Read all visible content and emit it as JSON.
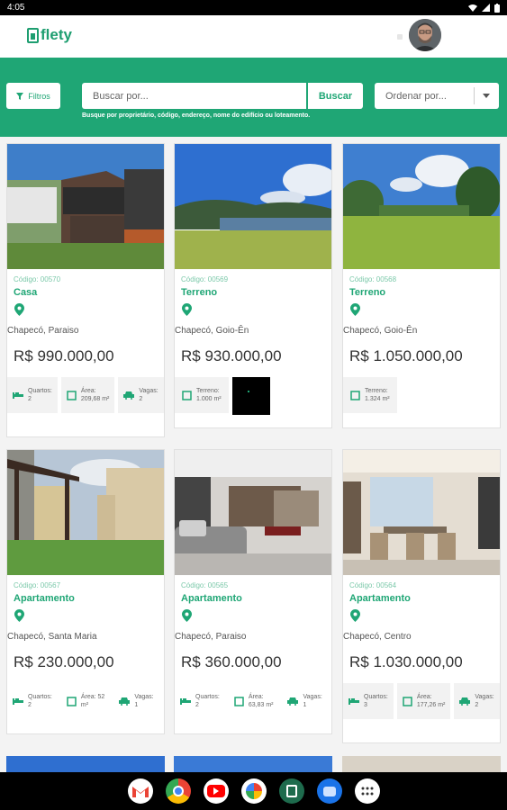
{
  "status": {
    "time": "4:05"
  },
  "app": {
    "brand": "flety"
  },
  "search": {
    "filter_label": "Filtros",
    "placeholder": "Buscar por...",
    "button_label": "Buscar",
    "sort_placeholder": "Ordenar por...",
    "hint": "Busque por proprietário, código, endereço, nome do edifício ou loteamento."
  },
  "listings": [
    {
      "code": "Código: 00570",
      "type": "Casa",
      "location": "Chapecó, Paraiso",
      "price": "R$ 990.000,00",
      "specs": [
        {
          "icon": "bed-icon",
          "label": "Quartos:",
          "value": "2"
        },
        {
          "icon": "area-icon",
          "label": "Área:",
          "value": "209,68 m²"
        },
        {
          "icon": "car-icon",
          "label": "Vagas:",
          "value": "2"
        }
      ]
    },
    {
      "code": "Código: 00569",
      "type": "Terreno",
      "location": "Chapecó, Goio-Ên",
      "price": "R$ 930.000,00",
      "specs": [
        {
          "icon": "area-icon",
          "label": "Terreno:",
          "value": "1.000 m²"
        }
      ]
    },
    {
      "code": "Código: 00568",
      "type": "Terreno",
      "location": "Chapecó, Goio-Ên",
      "price": "R$ 1.050.000,00",
      "specs": [
        {
          "icon": "area-icon",
          "label": "Terreno:",
          "value": "1.324 m²"
        }
      ]
    },
    {
      "code": "Código: 00567",
      "type": "Apartamento",
      "location": "Chapecó, Santa Maria",
      "price": "R$ 230.000,00",
      "specs": [
        {
          "icon": "bed-icon",
          "label": "Quartos:",
          "value": "2"
        },
        {
          "icon": "area-icon",
          "label": "Área: 52",
          "value": "m²"
        },
        {
          "icon": "car-icon",
          "label": "Vagas:",
          "value": "1"
        }
      ]
    },
    {
      "code": "Código: 00565",
      "type": "Apartamento",
      "location": "Chapecó, Paraiso",
      "price": "R$ 360.000,00",
      "specs": [
        {
          "icon": "bed-icon",
          "label": "Quartos:",
          "value": "2"
        },
        {
          "icon": "area-icon",
          "label": "Área:",
          "value": "63,83 m²"
        },
        {
          "icon": "car-icon",
          "label": "Vagas:",
          "value": "1"
        }
      ]
    },
    {
      "code": "Código: 00564",
      "type": "Apartamento",
      "location": "Chapecó, Centro",
      "price": "R$ 1.030.000,00",
      "specs": [
        {
          "icon": "bed-icon",
          "label": "Quartos:",
          "value": "3"
        },
        {
          "icon": "area-icon",
          "label": "Área:",
          "value": "177,26 m²"
        },
        {
          "icon": "car-icon",
          "label": "Vagas:",
          "value": "2"
        }
      ]
    }
  ],
  "dock": [
    "gmail-icon",
    "chrome-icon",
    "youtube-icon",
    "photos-icon",
    "flety-app-icon",
    "messages-icon",
    "apps-grid-icon"
  ],
  "colors": {
    "accent": "#1fa675",
    "text": "#333333"
  }
}
